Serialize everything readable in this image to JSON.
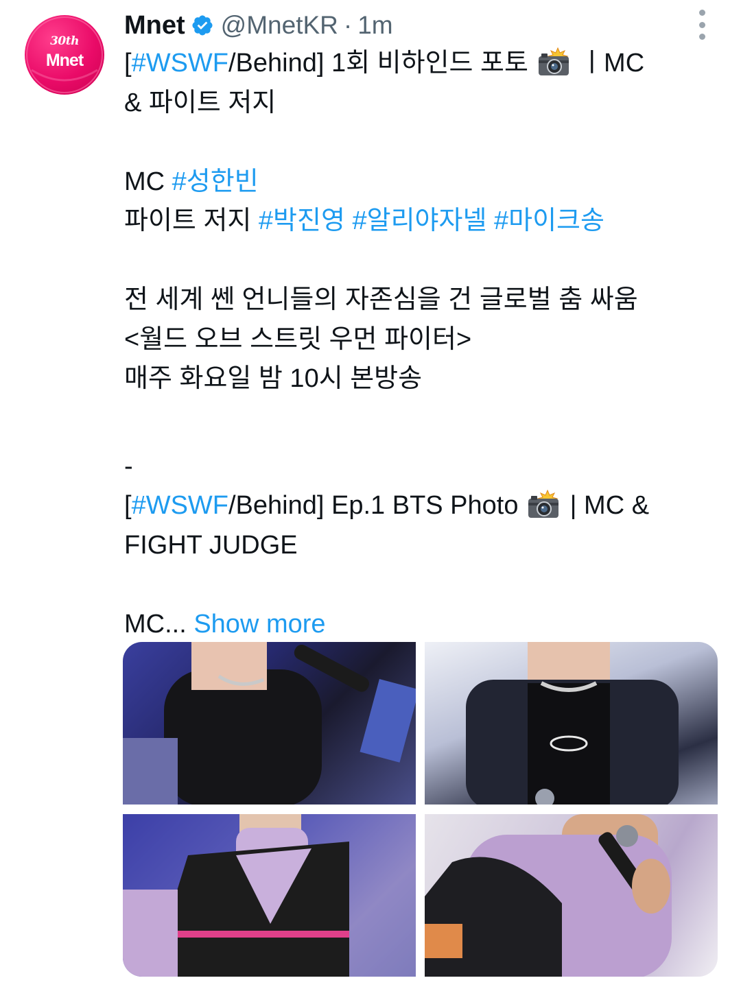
{
  "author": {
    "name": "Mnet",
    "handle": "@MnetKR",
    "separator": "·",
    "time": "1m",
    "avatar_text_top": "30th",
    "avatar_text_bottom": "Mnet",
    "avatar_color": "#ea0b68",
    "verified_color": "#1d9bf0"
  },
  "tweet": {
    "l1_open": "[",
    "l1_tag": "#WSWF",
    "l1_rest": "/Behind] 1회 비하인드 포토 ",
    "l1_end": " ㅣMC",
    "l2": "& 파이트 저지",
    "l3_prefix": "MC ",
    "l3_tag": "#성한빈",
    "l4_prefix": "파이트 저지 ",
    "l4_tag1": "#박진영",
    "l4_tag2": "#알리야자넬",
    "l4_tag3": "#마이크송",
    "l5": "전 세계 쎈 언니들의 자존심을 건 글로벌 춤 싸움",
    "l6": "<월드 오브 스트릿 우먼 파이터>",
    "l7": "매주 화요일 밤 10시 본방송",
    "l8": "-",
    "l9_open": "[",
    "l9_tag": "#WSWF",
    "l9_rest": "/Behind] Ep.1 BTS Photo ",
    "l9_end": " | MC &",
    "l10": "FIGHT JUDGE",
    "l11_prefix": "MC... ",
    "show_more": "Show more",
    "camera_icon": "camera-with-flash-icon",
    "link_color": "#1d9bf0"
  },
  "media": {
    "count": 4
  }
}
